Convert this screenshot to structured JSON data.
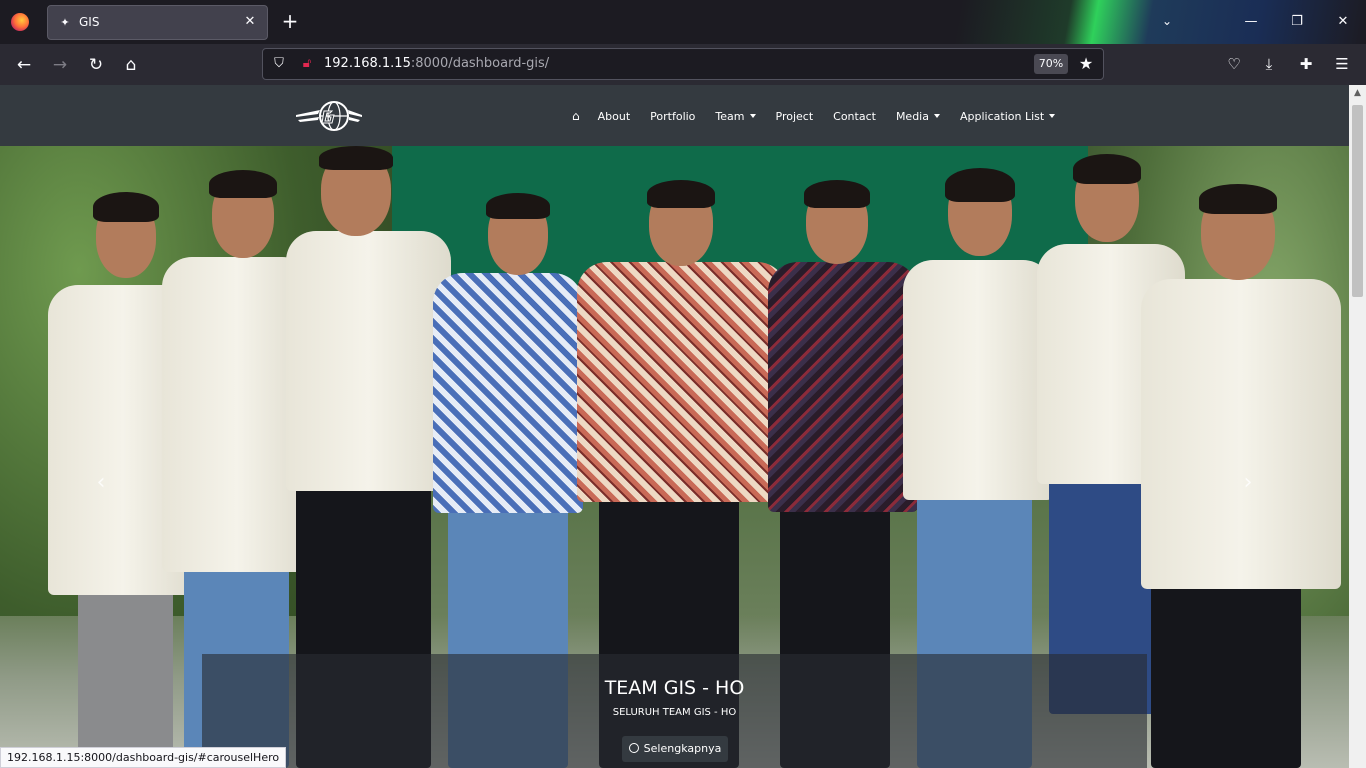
{
  "browser": {
    "tab": {
      "title": "GIS"
    },
    "new_tab_symbol": "+",
    "url": {
      "host": "192.168.1.15",
      "rest": ":8000/dashboard-gis/"
    },
    "zoom": "70%",
    "status_url": "192.168.1.15:8000/dashboard-gis/#carouselHero",
    "icons": {
      "back": "arrow-left-icon",
      "forward": "arrow-right-icon",
      "reload": "reload-icon",
      "home": "home-icon",
      "shield": "shield-icon",
      "lock": "insecure-lock-icon",
      "star": "star-icon",
      "pocket": "pocket-icon",
      "download": "download-icon",
      "extensions": "extensions-icon",
      "menu": "hamburger-icon"
    }
  },
  "site": {
    "menu": {
      "home_icon": "home-icon",
      "items": [
        "About",
        "Portfolio",
        "Team",
        "Project",
        "Contact",
        "Media",
        "Application List"
      ]
    },
    "hero": {
      "title": "TEAM GIS - HO",
      "subtitle": "SELURUH TEAM GIS - HO",
      "button_label": "Selengkapnya"
    }
  },
  "colors": {
    "navbar": "#343a40",
    "browser_chrome": "#1c1b22",
    "accent_green": "#2fd15b"
  }
}
